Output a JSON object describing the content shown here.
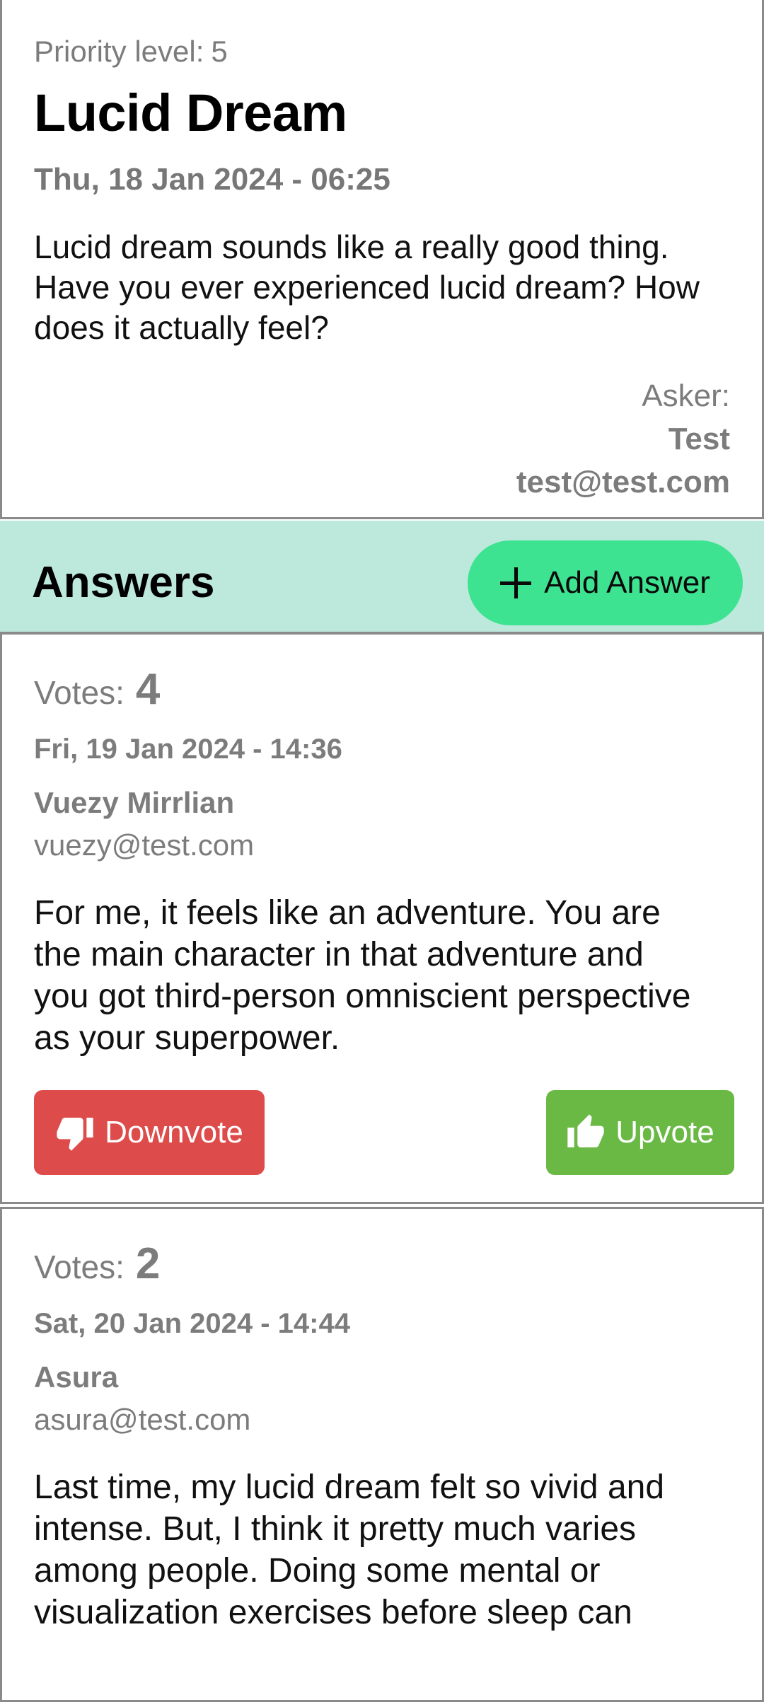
{
  "question": {
    "priority_label": "Priority level:",
    "priority_value": "5",
    "title": "Lucid Dream",
    "date": "Thu, 18 Jan 2024 - 06:25",
    "body": "Lucid dream sounds like a really good thing. Have you ever experienced lucid dream? How does it actually feel?",
    "asker_label": "Asker:",
    "asker_name": "Test",
    "asker_email": "test@test.com"
  },
  "answers_section": {
    "title": "Answers",
    "add_label": "Add Answer"
  },
  "answers": [
    {
      "votes_label": "Votes:",
      "votes": "4",
      "date": "Fri, 19 Jan 2024 - 14:36",
      "author": "Vuezy Mirrlian",
      "email": "vuezy@test.com",
      "body": "For me, it feels like an adventure. You are the main character in that adventure and you got third-person omniscient perspective as your superpower.",
      "downvote_label": "Downvote",
      "upvote_label": "Upvote"
    },
    {
      "votes_label": "Votes:",
      "votes": "2",
      "date": "Sat, 20 Jan 2024 - 14:44",
      "author": "Asura",
      "email": "asura@test.com",
      "body": "Last time, my lucid dream felt so vivid and intense. But, I think it pretty much varies among people. Doing some mental or visualization exercises before sleep can"
    }
  ],
  "colors": {
    "header_bg": "#bde9dd",
    "add_button": "#3ee391",
    "downvote": "#dd4b4b",
    "upvote": "#6ab945"
  },
  "icons": {
    "add": "plus-icon",
    "downvote": "thumbs-down-icon",
    "upvote": "thumbs-up-icon"
  }
}
